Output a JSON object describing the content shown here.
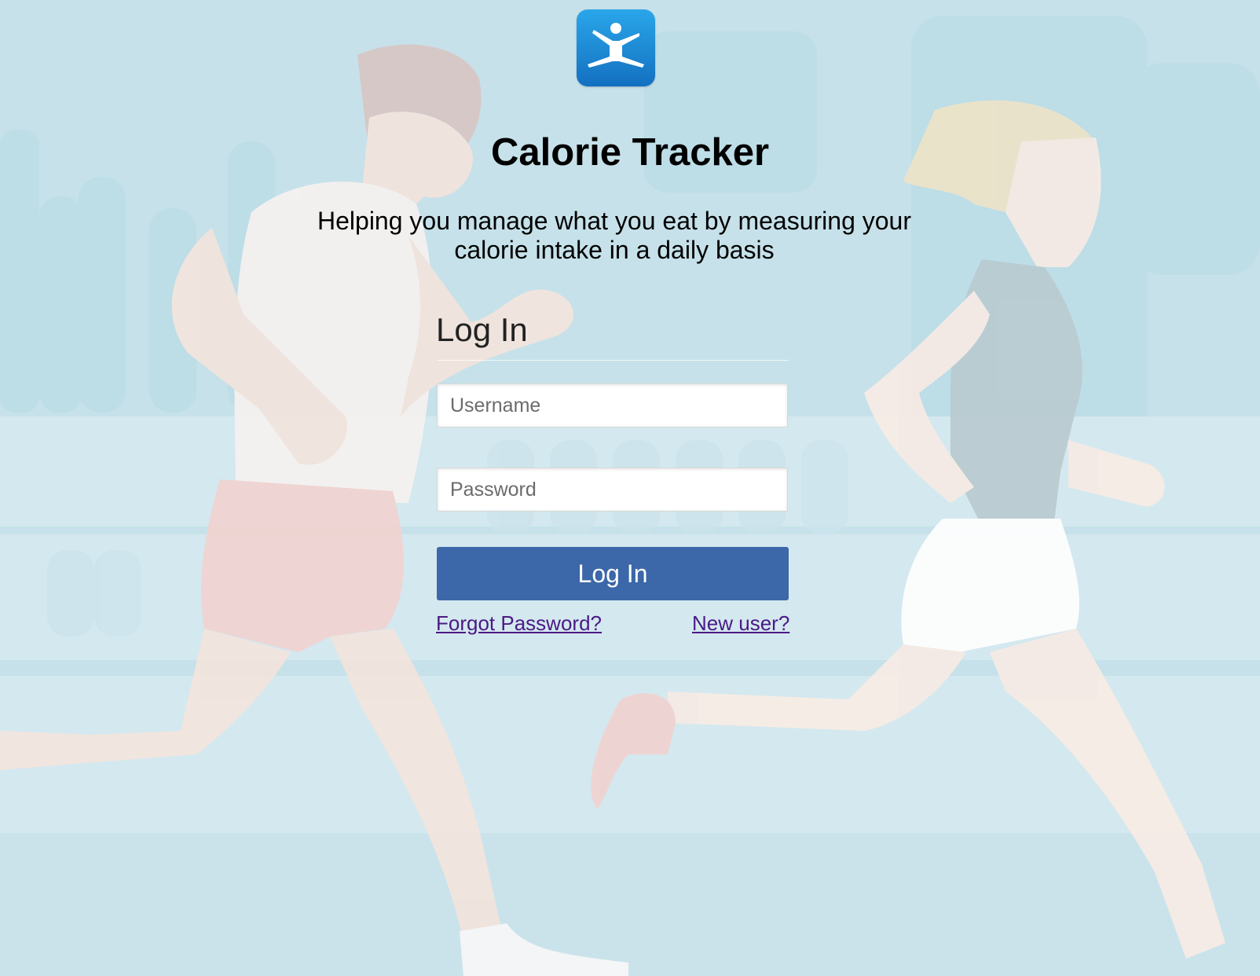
{
  "app": {
    "logo_icon": "running-figure-icon",
    "title": "Calorie Tracker",
    "subtitle": "Helping you manage what you eat by measuring your calorie intake in a daily basis"
  },
  "login": {
    "heading": "Log In",
    "username_placeholder": "Username",
    "password_placeholder": "Password",
    "submit_label": "Log In",
    "forgot_label": "Forgot Password?",
    "new_user_label": "New user?"
  },
  "colors": {
    "background": "#c6e1e9",
    "button": "#3c67a8",
    "link": "#4a1a85"
  }
}
